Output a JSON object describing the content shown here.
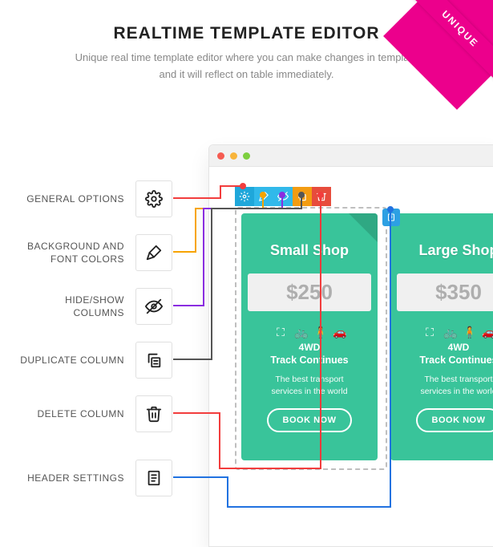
{
  "ribbon": "UNIQUE",
  "title": "REALTIME TEMPLATE EDITOR",
  "subtitle": "Unique real time template editor where you can make changes in template and it will reflect on table immediately.",
  "features": {
    "general": {
      "label": "GENERAL OPTIONS",
      "color": "#f23d3d"
    },
    "colors": {
      "label": "BACKGROUND AND\nFONT COLORS",
      "color": "#f7a400"
    },
    "hideshow": {
      "label": "HIDE/SHOW\nCOLUMNS",
      "color": "#8a2de0"
    },
    "duplicate": {
      "label": "DUPLICATE COLUMN",
      "color": "#555555"
    },
    "delete": {
      "label": "DELETE COLUMN",
      "color": "#f23d3d"
    },
    "header": {
      "label": "HEADER SETTINGS",
      "color": "#2172e0"
    }
  },
  "window": {
    "dots": [
      "#f55b51",
      "#f8b43a",
      "#7dcf3e"
    ]
  },
  "toolbar": {
    "items": [
      {
        "icon": "gear",
        "bg": "#1fa7da"
      },
      {
        "icon": "brush",
        "bg": "#31b9ea"
      },
      {
        "icon": "eye-off",
        "bg": "#31b9ea"
      },
      {
        "icon": "copy",
        "bg": "#f39c12"
      },
      {
        "icon": "trash",
        "bg": "#e74c3c"
      }
    ]
  },
  "cards": [
    {
      "name": "Small Shop",
      "price": "$250",
      "line1": "4WD",
      "line2": "Track Continues",
      "desc": "The best transport\nservices in the world",
      "cta": "BOOK NOW"
    },
    {
      "name": "Large Shop",
      "price": "$350",
      "line1": "4WD",
      "line2": "Track Continues",
      "desc": "The best transport\nservices in the world",
      "cta": "BOOK NOW"
    }
  ]
}
